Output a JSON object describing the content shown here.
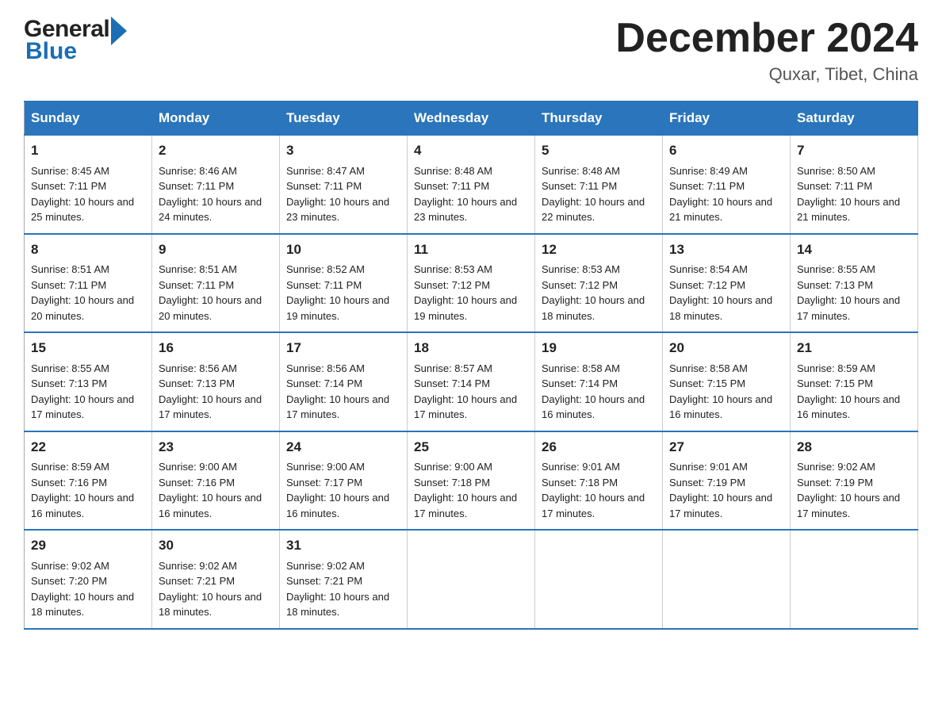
{
  "logo": {
    "line1": "General",
    "line2": "Blue"
  },
  "title": "December 2024",
  "location": "Quxar, Tibet, China",
  "days_of_week": [
    "Sunday",
    "Monday",
    "Tuesday",
    "Wednesday",
    "Thursday",
    "Friday",
    "Saturday"
  ],
  "weeks": [
    [
      {
        "day": "1",
        "sunrise": "8:45 AM",
        "sunset": "7:11 PM",
        "daylight": "10 hours and 25 minutes."
      },
      {
        "day": "2",
        "sunrise": "8:46 AM",
        "sunset": "7:11 PM",
        "daylight": "10 hours and 24 minutes."
      },
      {
        "day": "3",
        "sunrise": "8:47 AM",
        "sunset": "7:11 PM",
        "daylight": "10 hours and 23 minutes."
      },
      {
        "day": "4",
        "sunrise": "8:48 AM",
        "sunset": "7:11 PM",
        "daylight": "10 hours and 23 minutes."
      },
      {
        "day": "5",
        "sunrise": "8:48 AM",
        "sunset": "7:11 PM",
        "daylight": "10 hours and 22 minutes."
      },
      {
        "day": "6",
        "sunrise": "8:49 AM",
        "sunset": "7:11 PM",
        "daylight": "10 hours and 21 minutes."
      },
      {
        "day": "7",
        "sunrise": "8:50 AM",
        "sunset": "7:11 PM",
        "daylight": "10 hours and 21 minutes."
      }
    ],
    [
      {
        "day": "8",
        "sunrise": "8:51 AM",
        "sunset": "7:11 PM",
        "daylight": "10 hours and 20 minutes."
      },
      {
        "day": "9",
        "sunrise": "8:51 AM",
        "sunset": "7:11 PM",
        "daylight": "10 hours and 20 minutes."
      },
      {
        "day": "10",
        "sunrise": "8:52 AM",
        "sunset": "7:11 PM",
        "daylight": "10 hours and 19 minutes."
      },
      {
        "day": "11",
        "sunrise": "8:53 AM",
        "sunset": "7:12 PM",
        "daylight": "10 hours and 19 minutes."
      },
      {
        "day": "12",
        "sunrise": "8:53 AM",
        "sunset": "7:12 PM",
        "daylight": "10 hours and 18 minutes."
      },
      {
        "day": "13",
        "sunrise": "8:54 AM",
        "sunset": "7:12 PM",
        "daylight": "10 hours and 18 minutes."
      },
      {
        "day": "14",
        "sunrise": "8:55 AM",
        "sunset": "7:13 PM",
        "daylight": "10 hours and 17 minutes."
      }
    ],
    [
      {
        "day": "15",
        "sunrise": "8:55 AM",
        "sunset": "7:13 PM",
        "daylight": "10 hours and 17 minutes."
      },
      {
        "day": "16",
        "sunrise": "8:56 AM",
        "sunset": "7:13 PM",
        "daylight": "10 hours and 17 minutes."
      },
      {
        "day": "17",
        "sunrise": "8:56 AM",
        "sunset": "7:14 PM",
        "daylight": "10 hours and 17 minutes."
      },
      {
        "day": "18",
        "sunrise": "8:57 AM",
        "sunset": "7:14 PM",
        "daylight": "10 hours and 17 minutes."
      },
      {
        "day": "19",
        "sunrise": "8:58 AM",
        "sunset": "7:14 PM",
        "daylight": "10 hours and 16 minutes."
      },
      {
        "day": "20",
        "sunrise": "8:58 AM",
        "sunset": "7:15 PM",
        "daylight": "10 hours and 16 minutes."
      },
      {
        "day": "21",
        "sunrise": "8:59 AM",
        "sunset": "7:15 PM",
        "daylight": "10 hours and 16 minutes."
      }
    ],
    [
      {
        "day": "22",
        "sunrise": "8:59 AM",
        "sunset": "7:16 PM",
        "daylight": "10 hours and 16 minutes."
      },
      {
        "day": "23",
        "sunrise": "9:00 AM",
        "sunset": "7:16 PM",
        "daylight": "10 hours and 16 minutes."
      },
      {
        "day": "24",
        "sunrise": "9:00 AM",
        "sunset": "7:17 PM",
        "daylight": "10 hours and 16 minutes."
      },
      {
        "day": "25",
        "sunrise": "9:00 AM",
        "sunset": "7:18 PM",
        "daylight": "10 hours and 17 minutes."
      },
      {
        "day": "26",
        "sunrise": "9:01 AM",
        "sunset": "7:18 PM",
        "daylight": "10 hours and 17 minutes."
      },
      {
        "day": "27",
        "sunrise": "9:01 AM",
        "sunset": "7:19 PM",
        "daylight": "10 hours and 17 minutes."
      },
      {
        "day": "28",
        "sunrise": "9:02 AM",
        "sunset": "7:19 PM",
        "daylight": "10 hours and 17 minutes."
      }
    ],
    [
      {
        "day": "29",
        "sunrise": "9:02 AM",
        "sunset": "7:20 PM",
        "daylight": "10 hours and 18 minutes."
      },
      {
        "day": "30",
        "sunrise": "9:02 AM",
        "sunset": "7:21 PM",
        "daylight": "10 hours and 18 minutes."
      },
      {
        "day": "31",
        "sunrise": "9:02 AM",
        "sunset": "7:21 PM",
        "daylight": "10 hours and 18 minutes."
      },
      null,
      null,
      null,
      null
    ]
  ],
  "labels": {
    "sunrise": "Sunrise:",
    "sunset": "Sunset:",
    "daylight": "Daylight:"
  }
}
